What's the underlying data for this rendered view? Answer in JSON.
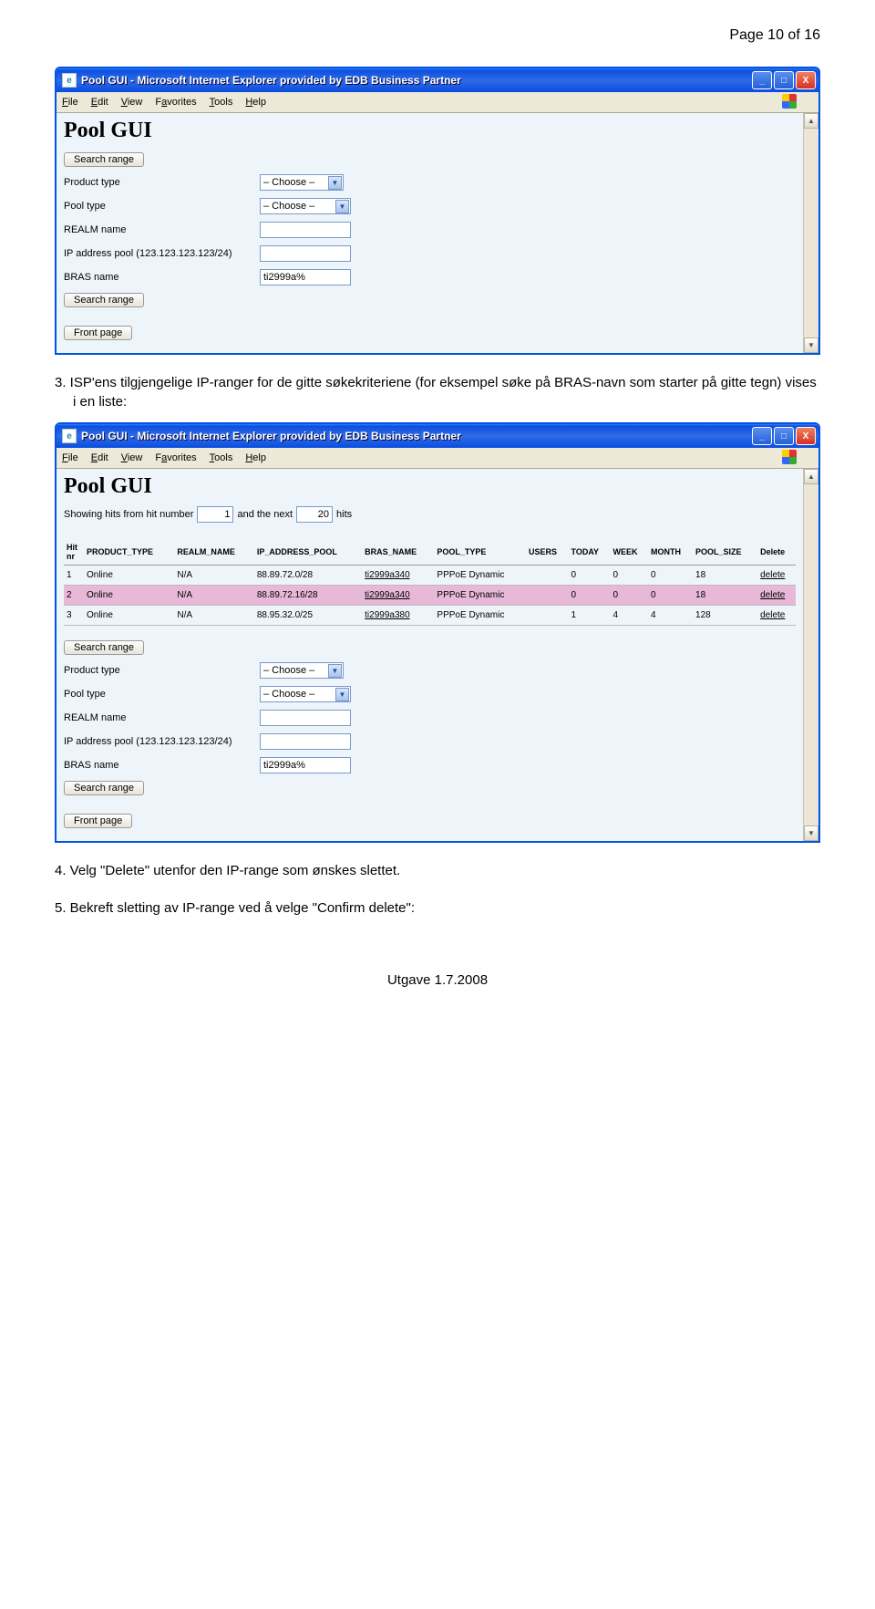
{
  "page_header": "Page 10 of 16",
  "footer": "Utgave 1.7.2008",
  "paragraphs": {
    "p3": "3. ISP'ens tilgjengelige IP-ranger for de gitte søkekriteriene (for eksempel søke på BRAS-navn som starter på gitte tegn) vises i en liste:",
    "p4": "4. Velg \"Delete\" utenfor den IP-range som ønskes slettet.",
    "p5": "5. Bekreft sletting av IP-range ved å velge \"Confirm delete\":"
  },
  "window": {
    "title": "Pool GUI - Microsoft Internet Explorer provided by EDB Business Partner",
    "menu": [
      "File",
      "Edit",
      "View",
      "Favorites",
      "Tools",
      "Help"
    ]
  },
  "app": {
    "title": "Pool GUI",
    "search_range_btn": "Search range",
    "front_page_btn": "Front page",
    "labels": {
      "product_type": "Product type",
      "pool_type": "Pool type",
      "realm_name": "REALM name",
      "ip_pool": "IP address pool (123.123.123.123/24)",
      "bras_name": "BRAS name"
    },
    "choose": "– Choose –",
    "bras_value": "ti2999a%"
  },
  "results": {
    "showing_pre": "Showing hits from hit number",
    "hit_from": "1",
    "showing_mid": "and the next",
    "hit_count": "20",
    "showing_post": "hits",
    "headers": [
      "Hit nr",
      "PRODUCT_TYPE",
      "REALM_NAME",
      "IP_ADDRESS_POOL",
      "BRAS_NAME",
      "POOL_TYPE",
      "USERS",
      "TODAY",
      "WEEK",
      "MONTH",
      "POOL_SIZE",
      "Delete"
    ],
    "rows": [
      {
        "hit": "1",
        "product": "Online",
        "realm": "N/A",
        "pool": "88.89.72.0/28",
        "bras": "ti2999a340",
        "ptype": "PPPoE Dynamic",
        "users": "",
        "today": "0",
        "week": "0",
        "month": "0",
        "size": "18",
        "del": "delete",
        "hl": false
      },
      {
        "hit": "2",
        "product": "Online",
        "realm": "N/A",
        "pool": "88.89.72.16/28",
        "bras": "ti2999a340",
        "ptype": "PPPoE Dynamic",
        "users": "",
        "today": "0",
        "week": "0",
        "month": "0",
        "size": "18",
        "del": "delete",
        "hl": true
      },
      {
        "hit": "3",
        "product": "Online",
        "realm": "N/A",
        "pool": "88.95.32.0/25",
        "bras": "ti2999a380",
        "ptype": "PPPoE Dynamic",
        "users": "",
        "today": "1",
        "week": "4",
        "month": "4",
        "size": "128",
        "del": "delete",
        "hl": false
      }
    ]
  }
}
